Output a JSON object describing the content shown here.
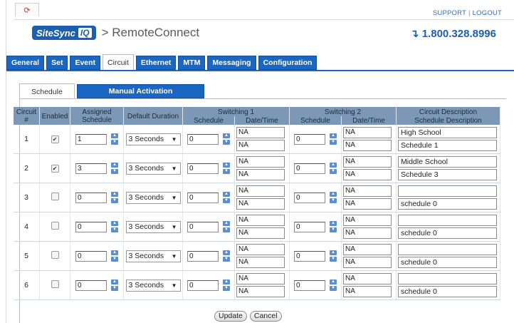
{
  "topbar": {
    "support": "SUPPORT",
    "logout": "LOGOUT",
    "home_icon": "home-icon"
  },
  "brand": {
    "logo_main": "SiteSync",
    "logo_iq": "IQ",
    "app": "> RemoteConnect",
    "phone": "↴ 1.800.328.8996"
  },
  "tabs": [
    "General",
    "Set",
    "Event",
    "Circuit",
    "Ethernet",
    "MTM",
    "Messaging",
    "Configuration"
  ],
  "active_tab": "Circuit",
  "subtabs": {
    "schedule": "Schedule",
    "manual": "Manual Activation"
  },
  "table": {
    "headers": {
      "circuit": "Circuit #",
      "enabled": "Enabled",
      "assigned": "Assigned Schedule",
      "duration": "Default Duration",
      "sw1": "Switching 1",
      "sw2": "Switching 2",
      "desc": "Circuit Description",
      "sched": "Schedule",
      "datetime": "Date/Time",
      "sched_desc": "Schedule Description"
    },
    "rows": [
      {
        "num": "1",
        "enabled": "✔",
        "assigned": "1",
        "duration": "3 Seconds",
        "sw1": "0",
        "sw1_a": "NA",
        "sw1_b": "NA",
        "sw2": "0",
        "sw2_a": "NA",
        "sw2_b": "NA",
        "desc": "High School",
        "sched_desc": "Schedule 1"
      },
      {
        "num": "2",
        "enabled": "✔",
        "assigned": "3",
        "duration": "3 Seconds",
        "sw1": "0",
        "sw1_a": "NA",
        "sw1_b": "NA",
        "sw2": "0",
        "sw2_a": "NA",
        "sw2_b": "NA",
        "desc": "Middle School",
        "sched_desc": "Schedule 3"
      },
      {
        "num": "3",
        "enabled": "",
        "assigned": "0",
        "duration": "3 Seconds",
        "sw1": "0",
        "sw1_a": "NA",
        "sw1_b": "NA",
        "sw2": "0",
        "sw2_a": "NA",
        "sw2_b": "NA",
        "desc": "",
        "sched_desc": "schedule 0"
      },
      {
        "num": "4",
        "enabled": "",
        "assigned": "0",
        "duration": "3 Seconds",
        "sw1": "0",
        "sw1_a": "NA",
        "sw1_b": "NA",
        "sw2": "0",
        "sw2_a": "NA",
        "sw2_b": "NA",
        "desc": "",
        "sched_desc": "schedule 0"
      },
      {
        "num": "5",
        "enabled": "",
        "assigned": "0",
        "duration": "3 Seconds",
        "sw1": "0",
        "sw1_a": "NA",
        "sw1_b": "NA",
        "sw2": "0",
        "sw2_a": "NA",
        "sw2_b": "NA",
        "desc": "",
        "sched_desc": "schedule 0"
      },
      {
        "num": "6",
        "enabled": "",
        "assigned": "0",
        "duration": "3 Seconds",
        "sw1": "0",
        "sw1_a": "NA",
        "sw1_b": "NA",
        "sw2": "0",
        "sw2_a": "NA",
        "sw2_b": "NA",
        "desc": "",
        "sched_desc": "schedule 0"
      }
    ]
  },
  "buttons": {
    "update": "Update",
    "cancel": "Cancel"
  },
  "colors": {
    "accent": "#1a66c2",
    "header_bg": "#7c98b6"
  }
}
